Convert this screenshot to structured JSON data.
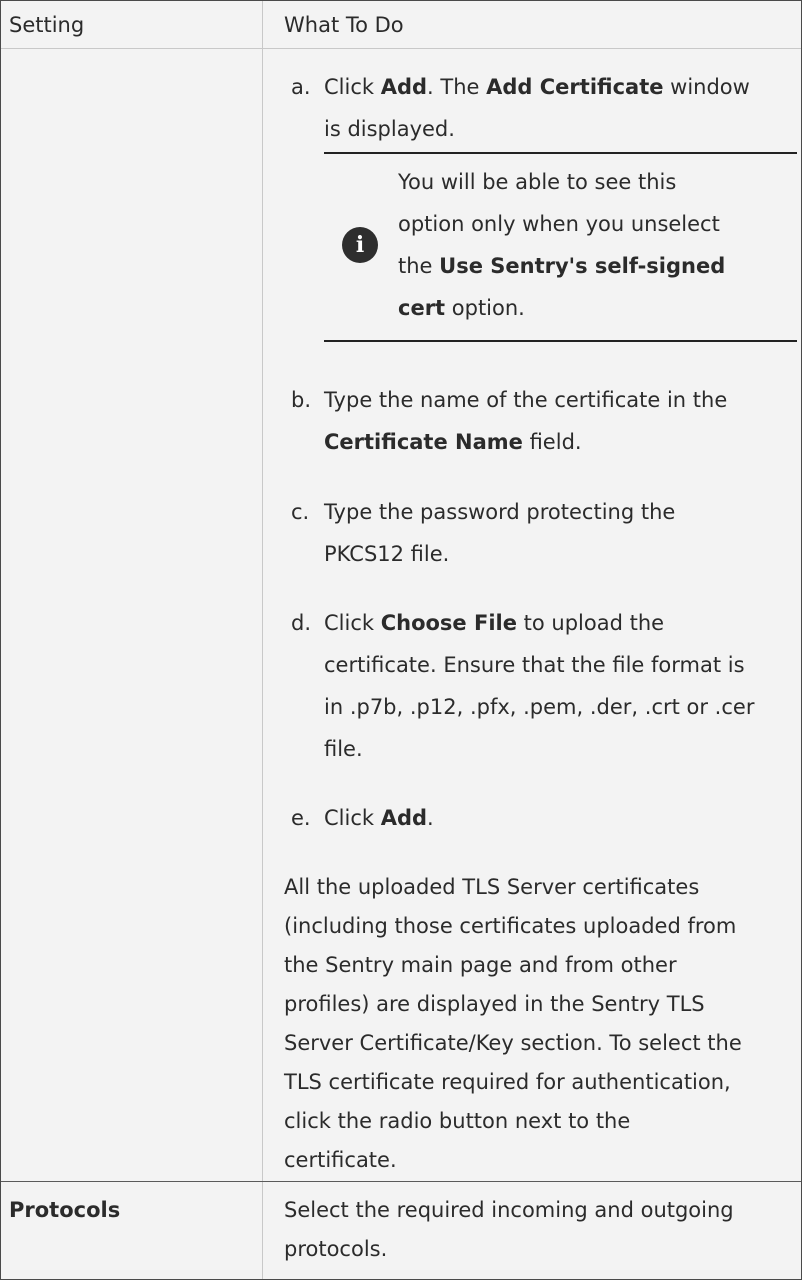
{
  "header": {
    "setting": "Setting",
    "what_to_do": "What To Do"
  },
  "steps": [
    {
      "mark": "a.",
      "lines": [
        [
          "Click ",
          "Add",
          ". The ",
          "Add Certificate",
          " window"
        ],
        [
          "is displayed."
        ]
      ]
    },
    {
      "mark": "b.",
      "lines": [
        [
          "Type the name of the certificate in the"
        ],
        [
          "Certificate Name",
          " field."
        ]
      ]
    },
    {
      "mark": "c.",
      "lines": [
        [
          "Type the password protecting the"
        ],
        [
          "PKCS12 file."
        ]
      ]
    },
    {
      "mark": "d.",
      "lines": [
        [
          "Click ",
          "Choose File",
          " to upload the"
        ],
        [
          "certificate. Ensure that the file format is"
        ],
        [
          "in .p7b, .p12, .pfx, .pem, .der, .crt or .cer"
        ],
        [
          "file."
        ]
      ]
    },
    {
      "mark": "e.",
      "lines": [
        [
          "Click ",
          "Add",
          "."
        ]
      ]
    }
  ],
  "note": {
    "l1": "You will be able to see this",
    "l2": "option only when you unselect",
    "l3_pre": "the ",
    "l3_bold": "Use Sentry's self-signed",
    "l4_bold": "cert",
    "l4_post": " option."
  },
  "paragraph": [
    "All the uploaded TLS Server certificates",
    "(including those certificates uploaded from",
    "the Sentry main page and from other",
    "profiles) are displayed in the Sentry TLS",
    "Server Certificate/Key section. To select the",
    "TLS certificate required for authentication,",
    "click the radio button next to the",
    "certificate."
  ],
  "protocols": {
    "setting": "Protocols",
    "line1": "Select the required incoming and outgoing",
    "line2": "protocols."
  }
}
